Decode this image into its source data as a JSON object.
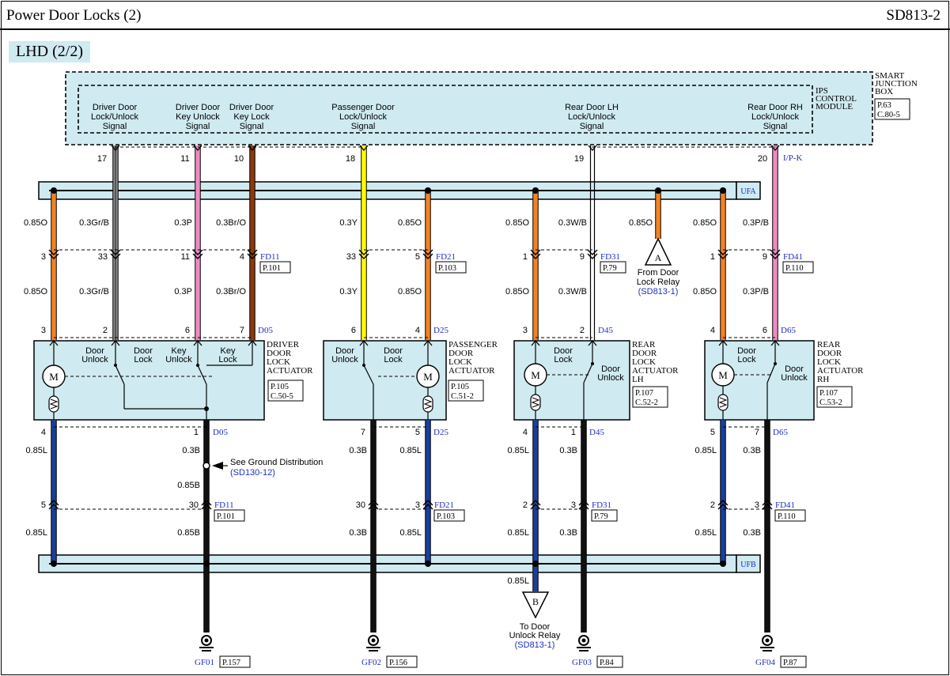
{
  "header": {
    "title": "Power Door Locks (2)",
    "code": "SD813-2"
  },
  "variant": "LHD (2/2)",
  "sjb": {
    "name": [
      "SMART",
      "JUNCTION",
      "BOX"
    ],
    "ref": [
      "P.63",
      "C.80-5"
    ],
    "ips": [
      "IPS",
      "CONTROL",
      "MODULE"
    ],
    "signals": [
      [
        "Driver Door",
        "Lock/Unlock",
        "Signal"
      ],
      [
        "Driver Door",
        "Key Unlock",
        "Signal"
      ],
      [
        "Driver Door",
        "Key  Lock",
        "Signal"
      ],
      [
        "Passenger Door",
        "Lock/Unlock",
        "Signal"
      ],
      [
        "Rear Door LH",
        "Lock/Unlock",
        "Signal"
      ],
      [
        "Rear Door RH",
        "Lock/Unlock",
        "Signal"
      ]
    ],
    "pins": [
      "17",
      "11",
      "10",
      "18",
      "19",
      "20"
    ],
    "ipk": "I/P-K"
  },
  "bus": {
    "ufa": "UFA",
    "ufb": "UFB"
  },
  "wires_top_upper": [
    "0.85O",
    "0.3Gr/B",
    "0.3P",
    "0.3Br/O",
    "0.3Y",
    "0.85O",
    "0.85O",
    "0.3W/B",
    "0.85O",
    "0.85O",
    "0.3P/B"
  ],
  "wires_top_lower": [
    "0.85O",
    "0.3Gr/B",
    "0.3P",
    "0.3Br/O",
    "0.3Y",
    "0.85O",
    "0.85O",
    "0.3W/B",
    "0.85O",
    "0.3P/B"
  ],
  "conn_top": {
    "fd11": {
      "pins": [
        "3",
        "33",
        "11",
        "4"
      ],
      "name": "FD11",
      "page": "P.101"
    },
    "fd21": {
      "pins": [
        "33",
        "5"
      ],
      "name": "FD21",
      "page": "P.103"
    },
    "fd31": {
      "pins": [
        "1",
        "9"
      ],
      "name": "FD31",
      "page": "P.79"
    },
    "fd41": {
      "pins": [
        "1",
        "9"
      ],
      "name": "FD41",
      "page": "P.110"
    }
  },
  "relay_a": {
    "letter": "A",
    "text": [
      "From Door",
      "Lock Relay"
    ],
    "ref": "(SD813-1)"
  },
  "actuators": {
    "driver": {
      "pins": [
        "3",
        "2",
        "6",
        "7"
      ],
      "conn": "D05",
      "name": [
        "DRIVER",
        "DOOR",
        "LOCK",
        "ACTUATOR"
      ],
      "ref": [
        "P.105",
        "C.50-5"
      ],
      "labels": [
        [
          "Door",
          "Unlock"
        ],
        [
          "Door",
          "Lock"
        ],
        [
          "Key",
          "Unlock"
        ],
        [
          "Key",
          "Lock"
        ]
      ],
      "bottom_pins": [
        "4",
        "1"
      ]
    },
    "passenger": {
      "pins": [
        "6",
        "4"
      ],
      "conn": "D25",
      "name": [
        "PASSENGER",
        "DOOR",
        "LOCK",
        "ACTUATOR"
      ],
      "ref": [
        "P.105",
        "C.51-2"
      ],
      "labels": [
        [
          "Door",
          "Unlock"
        ],
        [
          "Door",
          "Lock"
        ]
      ],
      "bottom_pins": [
        "7",
        "5"
      ]
    },
    "rear_lh": {
      "pins": [
        "3",
        "2"
      ],
      "conn": "D45",
      "name": [
        "REAR",
        "DOOR",
        "LOCK",
        "ACTUATOR",
        "LH"
      ],
      "ref": [
        "P.107",
        "C.52-2"
      ],
      "labels": [
        [
          "Door",
          "Lock"
        ],
        [
          "Door",
          "Unlock"
        ]
      ],
      "bottom_pins": [
        "4",
        "1"
      ]
    },
    "rear_rh": {
      "pins": [
        "4",
        "6"
      ],
      "conn": "D65",
      "name": [
        "REAR",
        "DOOR",
        "LOCK",
        "ACTUATOR",
        "RH"
      ],
      "ref": [
        "P.107",
        "C.53-2"
      ],
      "labels": [
        [
          "Door",
          "Lock"
        ],
        [
          "Door",
          "Unlock"
        ]
      ],
      "bottom_pins": [
        "5",
        "7"
      ]
    },
    "motor": "M"
  },
  "wires_bottom_upper": [
    "0.85L",
    "0.3B",
    "0.85B",
    "0.3B",
    "0.85L",
    "0.85L",
    "0.3B",
    "0.85L",
    "0.3B"
  ],
  "wires_bottom_lower": [
    "0.85L",
    "0.85B",
    "0.3B",
    "0.85L",
    "0.85L",
    "0.3B",
    "0.85L",
    "0.3B"
  ],
  "ground_note": {
    "text": "See Ground Distribution",
    "ref": "(SD130-12)"
  },
  "conn_bottom": {
    "fd11": {
      "pins": [
        "5",
        "30"
      ],
      "name": "FD11",
      "page": "P.101"
    },
    "fd21": {
      "pins": [
        "30",
        "3"
      ],
      "name": "FD21",
      "page": "P.103"
    },
    "fd31": {
      "pins": [
        "2",
        "3"
      ],
      "name": "FD31",
      "page": "P.79"
    },
    "fd41": {
      "pins": [
        "2",
        "3"
      ],
      "name": "FD41",
      "page": "P.110"
    }
  },
  "relay_b": {
    "letter": "B",
    "wire": "0.85L",
    "text": [
      "To Door",
      "Unlock Relay"
    ],
    "ref": "(SD813-1)"
  },
  "grounds": [
    {
      "name": "GF01",
      "page": "P.157"
    },
    {
      "name": "GF02",
      "page": "P.156"
    },
    {
      "name": "GF03",
      "page": "P.84"
    },
    {
      "name": "GF04",
      "page": "P.87"
    }
  ],
  "colors": {
    "orange": "#f58220",
    "pink": "#f08ac0",
    "brown": "#8b3a0e",
    "yellow": "#ffff00",
    "gray": "#8c8c8c",
    "blue": "#1a3e9a",
    "black": "#111111",
    "box": "#cfeaf0",
    "link": "#1f2fbf"
  }
}
